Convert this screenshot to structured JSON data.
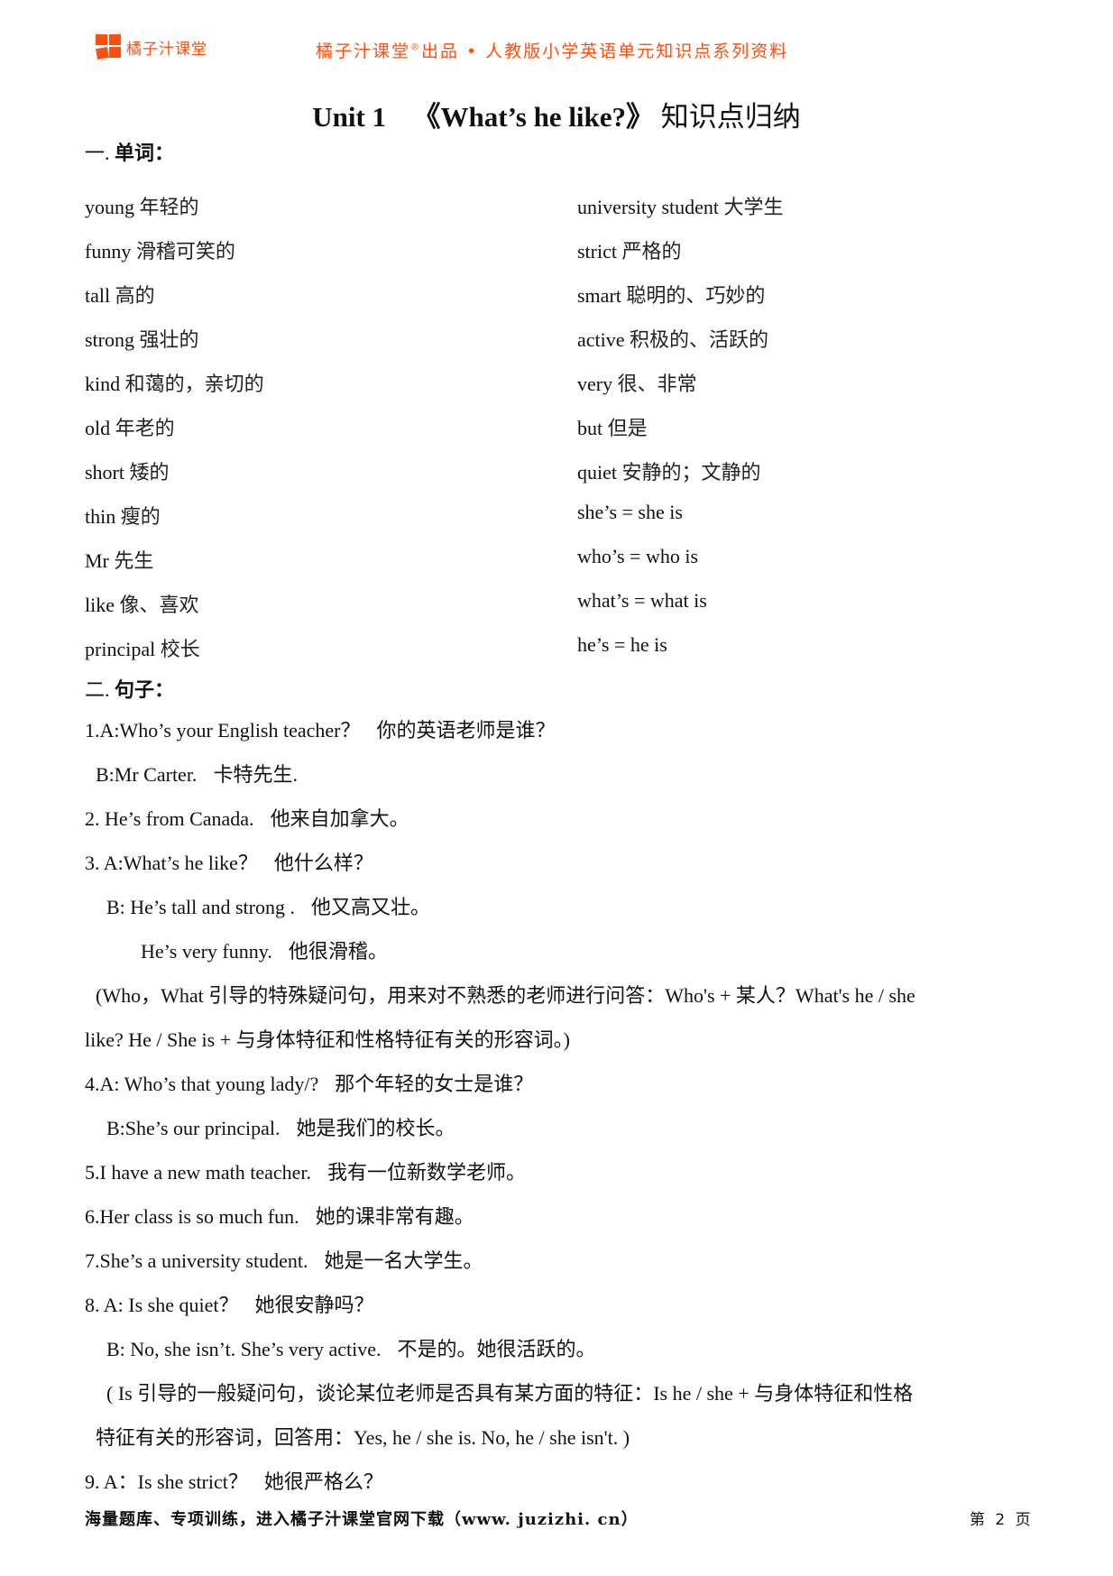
{
  "header": {
    "brand": "橘子汁课堂",
    "title_prefix": "橘子汁课堂",
    "registered": "®",
    "title_suffix": "出品 • 人教版小学英语单元知识点系列资料",
    "logo_color": "#ff4e0e"
  },
  "page_title": {
    "unit": "Unit 1",
    "english": "《What’s he like?》",
    "chinese": "知识点归纳"
  },
  "section_words": {
    "number": "一.",
    "label": "单词："
  },
  "vocab": [
    {
      "left_en": "young",
      "left_zh": "年轻的",
      "right_en": "university student",
      "right_zh": "大学生"
    },
    {
      "left_en": "funny",
      "left_zh": "滑稽可笑的",
      "right_en": "strict",
      "right_zh": "严格的"
    },
    {
      "left_en": "tall",
      "left_zh": "高的",
      "right_en": "smart",
      "right_zh": "聪明的、巧妙的"
    },
    {
      "left_en": "strong",
      "left_zh": "强壮的",
      "right_en": "active",
      "right_zh": "积极的、活跃的"
    },
    {
      "left_en": "kind",
      "left_zh": "和蔼的，亲切的",
      "right_en": "very",
      "right_zh": "很、非常"
    },
    {
      "left_en": "old",
      "left_zh": "年老的",
      "right_en": "but",
      "right_zh": "但是"
    },
    {
      "left_en": "short",
      "left_zh": "矮的",
      "right_en": "quiet",
      "right_zh": "安静的；文静的"
    },
    {
      "left_en": "thin",
      "left_zh": "瘦的",
      "right_en": "she’s = she is",
      "right_zh": ""
    },
    {
      "left_en": "Mr",
      "left_zh": "先生",
      "right_en": "who’s = who is",
      "right_zh": ""
    },
    {
      "left_en": "like",
      "left_zh": "像、喜欢",
      "right_en": "what’s = what is",
      "right_zh": ""
    },
    {
      "left_en": "principal",
      "left_zh": "校长",
      "right_en": "he’s = he is",
      "right_zh": ""
    }
  ],
  "section_sentences": {
    "number": "二.",
    "label": "句子："
  },
  "sentences": [
    {
      "en": "1.A:Who’s your English teacher？",
      "zh": "你的英语老师是谁？",
      "indent": "none"
    },
    {
      "en": "B:Mr Carter.",
      "zh": "卡特先生.",
      "indent": "ind1"
    },
    {
      "en": "2. He’s from Canada.",
      "zh": "他来自加拿大。",
      "indent": "none"
    },
    {
      "en": "3. A:What’s he like？",
      "zh": "他什么样？",
      "indent": "none"
    },
    {
      "en": "B: He’s tall and strong .",
      "zh": "他又高又壮。",
      "indent": "ind2"
    },
    {
      "en": "He’s very funny.",
      "zh": "他很滑稽。",
      "indent": "ind3"
    },
    {
      "en": "(Who，What 引导的特殊疑问句，用来对不熟悉的老师进行问答：Who's + 某人？What's he / she",
      "zh": "",
      "indent": "ind1"
    },
    {
      "en": "like? He / She is + 与身体特征和性格特征有关的形容词。)",
      "zh": "",
      "indent": "none"
    },
    {
      "en": "4.A: Who’s that young lady/?",
      "zh": "那个年轻的女士是谁？",
      "indent": "none"
    },
    {
      "en": "B:She’s our principal.",
      "zh": "她是我们的校长。",
      "indent": "ind2"
    },
    {
      "en": "5.I have a new math teacher.",
      "zh": "我有一位新数学老师。",
      "indent": "none"
    },
    {
      "en": "6.Her class is so much fun.",
      "zh": "她的课非常有趣。",
      "indent": "none"
    },
    {
      "en": "7.She’s a university student.",
      "zh": "她是一名大学生。",
      "indent": "none"
    },
    {
      "en": "8. A: Is she quiet？",
      "zh": "她很安静吗？",
      "indent": "none"
    },
    {
      "en": "B: No, she isn’t. She’s very active.",
      "zh": "不是的。她很活跃的。",
      "indent": "ind2"
    },
    {
      "en": "( Is 引导的一般疑问句，谈论某位老师是否具有某方面的特征：Is he / she + 与身体特征和性格",
      "zh": "",
      "indent": "ind2"
    },
    {
      "en": "特征有关的形容词，回答用：Yes, he / she is. No, he / she isn't. )",
      "zh": "",
      "indent": "ind1"
    },
    {
      "en": "9. A：Is she strict？",
      "zh": "她很严格么？",
      "indent": "none"
    }
  ],
  "footer": {
    "promo": "海量题库、专项训练，进入橘子汁课堂官网下载（www. juzizhi. cn）",
    "page_label": "第 2 页"
  }
}
